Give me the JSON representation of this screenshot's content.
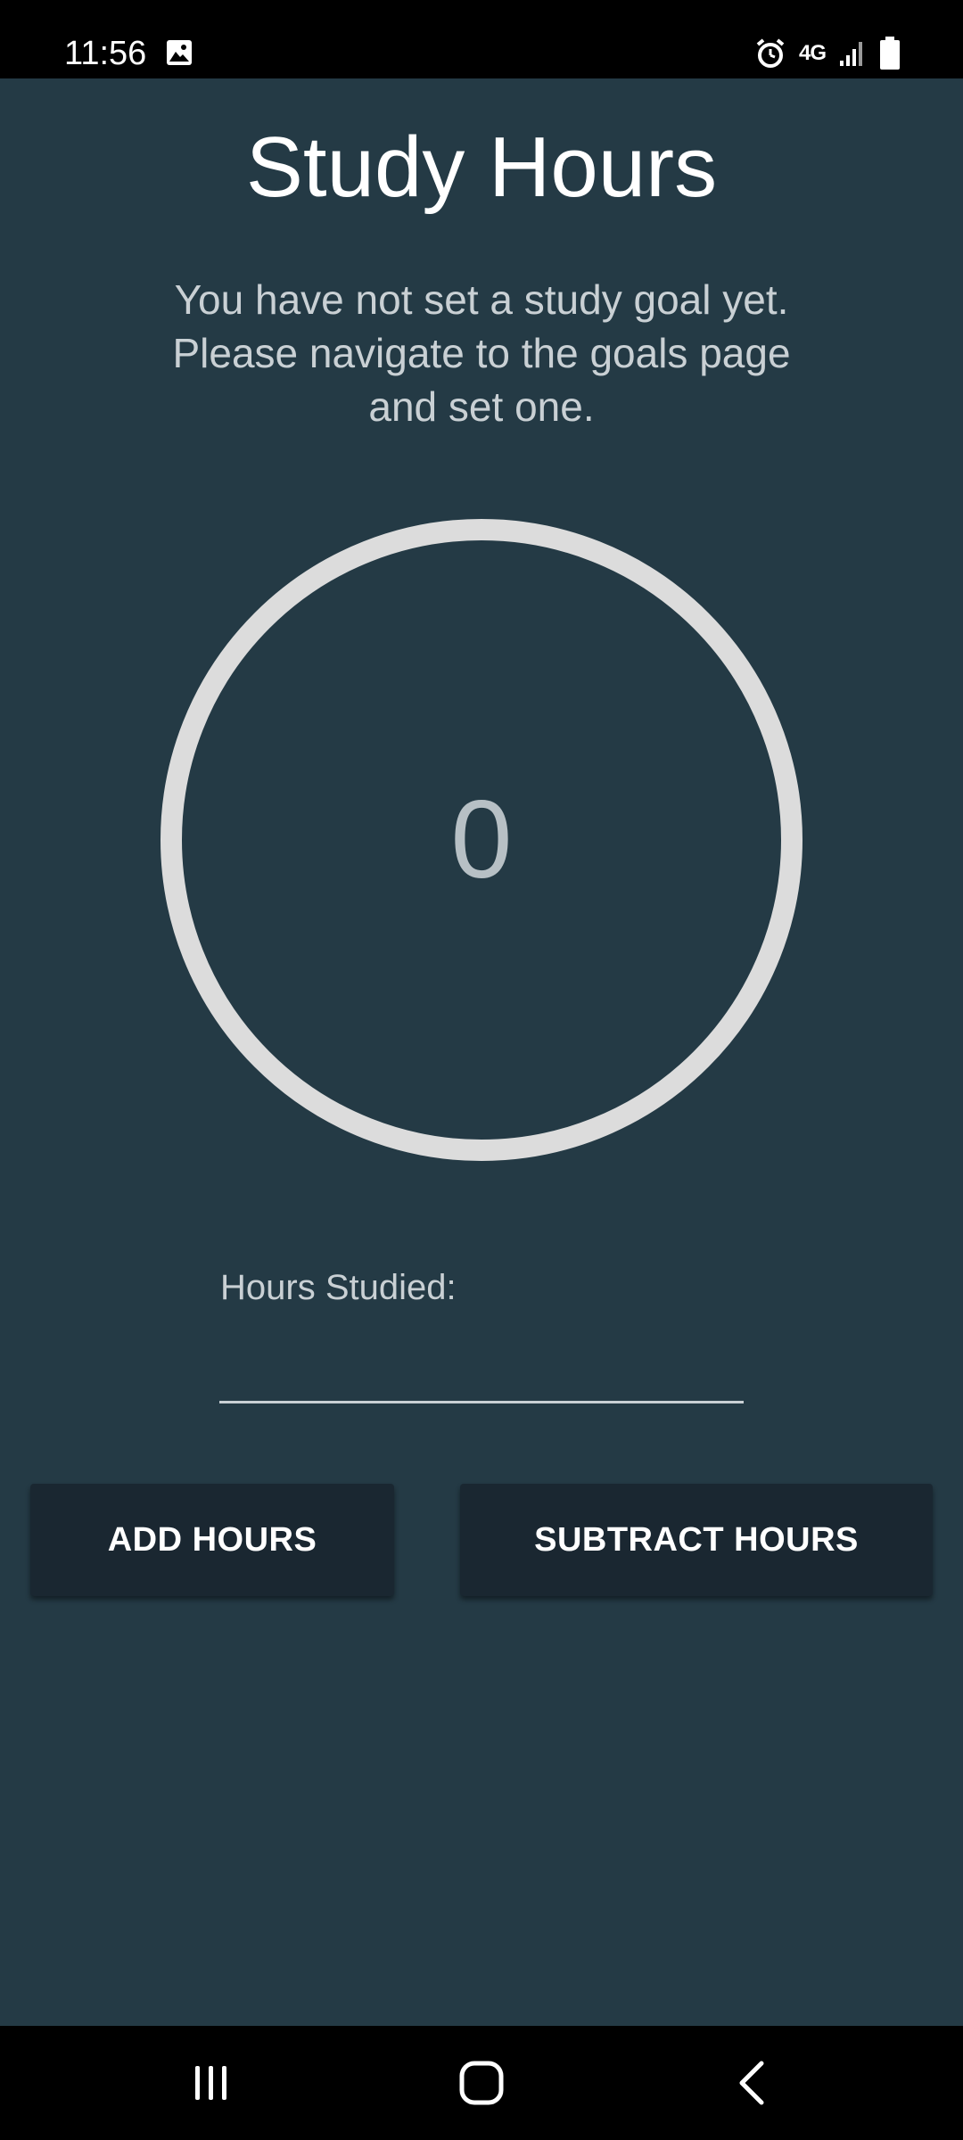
{
  "status_bar": {
    "time": "11:56",
    "network_label": "4G",
    "icons": [
      "image-icon",
      "alarm-icon",
      "signal-icon",
      "battery-icon"
    ]
  },
  "main": {
    "title": "Study Hours",
    "goal_message": "You have not set a study goal yet. Please navigate to the goals page and set one.",
    "hours_count": "0",
    "hours_label": "Hours Studied:",
    "hours_input_value": "",
    "add_button_label": "ADD HOURS",
    "subtract_button_label": "SUBTRACT HOURS"
  },
  "nav_bar": {
    "icons": [
      "recents-icon",
      "home-icon",
      "back-icon"
    ]
  },
  "colors": {
    "background": "#243a45",
    "button_background": "#1a2731",
    "ring": "#dcdcdc",
    "text_primary": "#ffffff",
    "text_secondary": "#c9d0d4"
  }
}
